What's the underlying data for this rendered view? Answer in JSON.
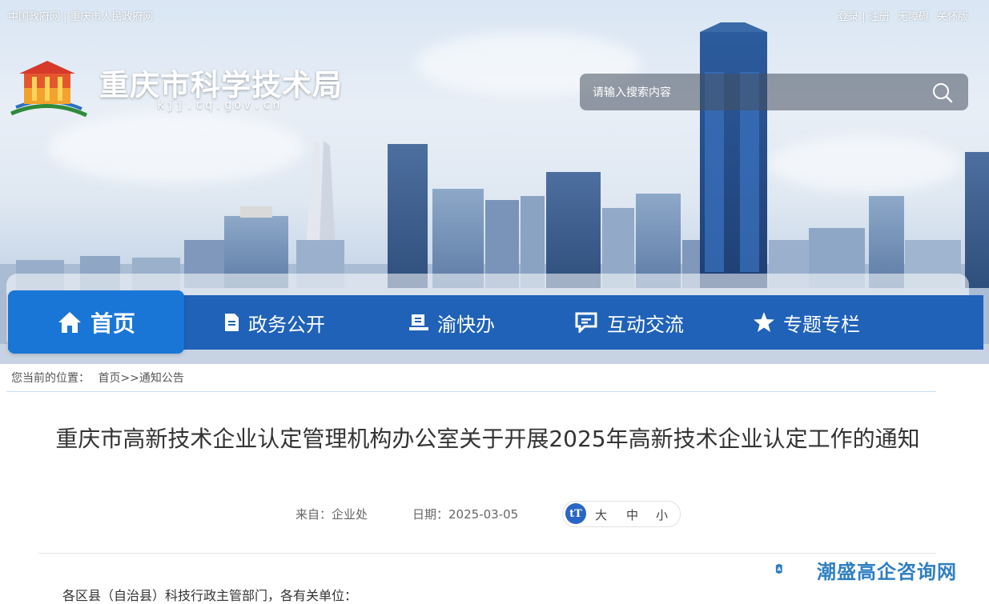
{
  "topbar": {
    "left_links": [
      "中国政府网",
      "重庆市人民政府网"
    ],
    "left_separator": "|",
    "right_links": [
      "登录",
      "注册",
      "无障碍",
      "关怀版"
    ],
    "right_separator": "|"
  },
  "site": {
    "name": "重庆市科学技术局",
    "domain": "kjj.cq.gov.cn"
  },
  "search": {
    "placeholder": "请输入搜索内容"
  },
  "nav": {
    "home": "首页",
    "items": [
      "政务公开",
      "渝快办",
      "互动交流",
      "专题专栏"
    ]
  },
  "breadcrumb": {
    "prefix": "您当前的位置：",
    "home": "首页",
    "separator": ">>",
    "current": "通知公告"
  },
  "article": {
    "title": "重庆市高新技术企业认定管理机构办公室关于开展2025年高新技术企业认定工作的通知",
    "source_label": "来自：",
    "source": "企业处",
    "date_label": "日期：",
    "date": "2025-03-05",
    "font_icon": "tT",
    "font_sizes": [
      "大",
      "中",
      "小"
    ],
    "body_first_line": "各区县（自治县）科技行政主管部门，各有关单位："
  },
  "watermark": {
    "text": "潮盛高企咨询网"
  },
  "colors": {
    "nav_bg": "#1f62b8",
    "nav_home_bg": "#1a76d6",
    "accent": "#2a66c4"
  }
}
